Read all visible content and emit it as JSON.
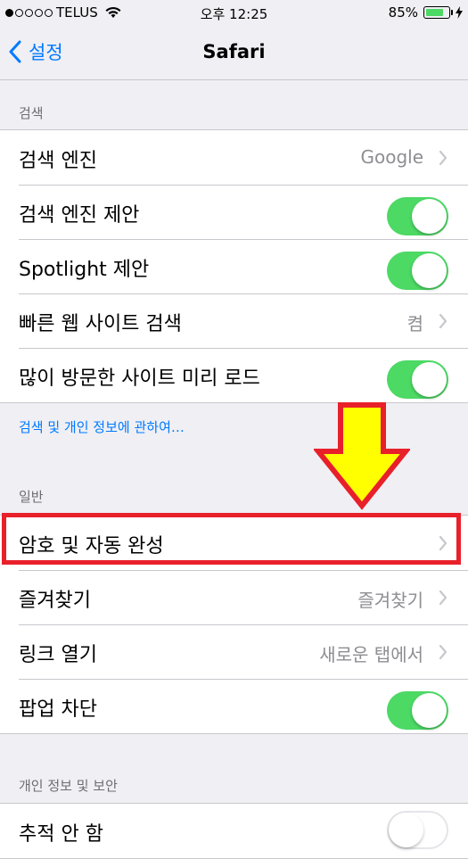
{
  "status_bar": {
    "carrier": "TELUS",
    "time": "오후 12:25",
    "battery": "85%",
    "battery_level": 0.85
  },
  "nav": {
    "back_label": "설정",
    "title": "Safari"
  },
  "sections": {
    "search": {
      "header": "검색",
      "rows": {
        "search_engine": {
          "label": "검색 엔진",
          "value": "Google"
        },
        "engine_suggestions": {
          "label": "검색 엔진 제안",
          "on": true
        },
        "spotlight": {
          "label": "Spotlight 제안",
          "on": true
        },
        "quick_website_search": {
          "label": "빠른 웹 사이트 검색",
          "value": "켬"
        },
        "preload_top_hit": {
          "label": "많이 방문한 사이트 미리 로드",
          "on": true
        }
      },
      "footer_link": "검색 및 개인 정보에 관하여…"
    },
    "general": {
      "header": "일반",
      "rows": {
        "passwords_autofill": {
          "label": "암호 및 자동 완성"
        },
        "favorites": {
          "label": "즐겨찾기",
          "value": "즐겨찾기"
        },
        "open_links": {
          "label": "링크 열기",
          "value": "새로운 탭에서"
        },
        "block_popups": {
          "label": "팝업 차단",
          "on": true
        }
      }
    },
    "privacy": {
      "header": "개인 정보 및 보안",
      "rows": {
        "do_not_track": {
          "label": "추적 안 함",
          "on": false
        }
      }
    }
  },
  "colors": {
    "accent": "#007aff",
    "toggle_on": "#4cd964",
    "highlight": "#e8202a",
    "arrow_fill": "#ffff00"
  }
}
